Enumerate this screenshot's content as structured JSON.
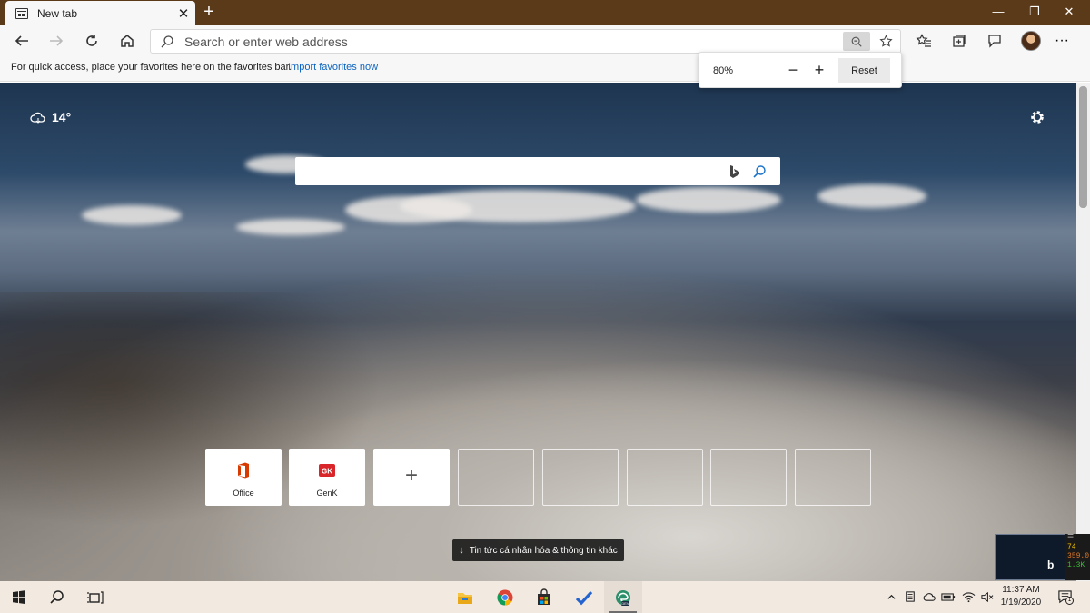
{
  "browser": {
    "tab": {
      "title": "New tab",
      "favicon": "newtab-icon"
    },
    "new_tab_symbol": "+",
    "window_controls": {
      "minimize": "—",
      "maximize": "❐",
      "close": "✕"
    }
  },
  "toolbar": {
    "address_placeholder": "Search or enter web address",
    "icons": [
      "back-icon",
      "forward-icon",
      "refresh-icon",
      "home-icon",
      "zoom-icon",
      "star-icon",
      "favorites-icon",
      "collections-icon",
      "feedback-icon",
      "profile-avatar",
      "more-icon"
    ],
    "more_label": "···"
  },
  "favorites_bar": {
    "text": "For quick access, place your favorites here on the favorites bar.",
    "link": "Import favorites now"
  },
  "zoom_popup": {
    "value": "80%",
    "minus": "−",
    "plus": "+",
    "reset": "Reset"
  },
  "ntp": {
    "weather": {
      "icon": "cloud-icon",
      "temperature": "14°"
    },
    "tiles": [
      {
        "label": "Office",
        "icon": "office-icon"
      },
      {
        "label": "GenK",
        "icon": "genk-icon"
      },
      {
        "label": "",
        "icon": "add-icon",
        "symbol": "+"
      }
    ],
    "empty_tiles": 5,
    "news_button": {
      "arrow": "↓",
      "label": "Tin tức cá nhân hóa & thông tin khác"
    }
  },
  "overlay": {
    "mini_icon": "b",
    "stats": [
      "74",
      "359.0",
      "1.3K"
    ]
  },
  "taskbar": {
    "pinned": [
      "start-icon",
      "search-icon",
      "task-view-icon",
      "file-explorer-icon",
      "chrome-icon",
      "store-icon",
      "todo-icon",
      "edge-dev-icon"
    ],
    "clock": {
      "time": "11:37 AM",
      "date": "1/19/2020"
    },
    "notification_count": "1"
  },
  "colors": {
    "titlebar": "#5b3a1a",
    "link": "#0c64c0",
    "office_red": "#d83b01",
    "genk_red": "#d9262a",
    "taskbar": "#f2e9e1"
  }
}
